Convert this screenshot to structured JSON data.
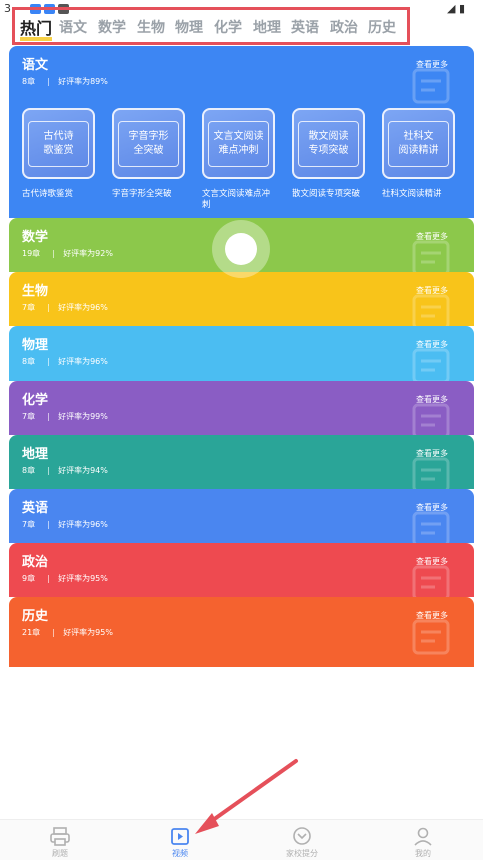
{
  "status_bar": {
    "time": "3",
    "app_icon_colors": [
      "#3a84f5",
      "#3a84f5",
      "#555555"
    ]
  },
  "tabs": [
    {
      "label": "热门",
      "active": true
    },
    {
      "label": "语文"
    },
    {
      "label": "数学"
    },
    {
      "label": "生物"
    },
    {
      "label": "物理"
    },
    {
      "label": "化学"
    },
    {
      "label": "地理"
    },
    {
      "label": "英语"
    },
    {
      "label": "政治"
    },
    {
      "label": "历史"
    }
  ],
  "subjects": [
    {
      "name": "语文",
      "chapters": "8章",
      "rating": "好评率为89%",
      "more": "查看更多",
      "color": "#3d86f3",
      "icon": "notebook-icon",
      "courses": [
        {
          "thumb_text": "古代诗\n歌鉴赏",
          "caption": "古代诗歌鉴赏"
        },
        {
          "thumb_text": "字音字形\n全突破",
          "caption": "字音字形全突破"
        },
        {
          "thumb_text": "文言文阅读\n难点冲刺",
          "caption": "文言文阅读难点冲刺"
        },
        {
          "thumb_text": "散文阅读\n专项突破",
          "caption": "散文阅读专项突破"
        },
        {
          "thumb_text": "社科文\n阅读精讲",
          "caption": "社科文阅读精讲"
        }
      ]
    },
    {
      "name": "数学",
      "chapters": "19章",
      "rating": "好评率为92%",
      "more": "查看更多",
      "color": "#8cc84b",
      "icon": "math-board-icon"
    },
    {
      "name": "生物",
      "chapters": "7章",
      "rating": "好评率为96%",
      "more": "查看更多",
      "color": "#f8c41a",
      "icon": "dna-icon"
    },
    {
      "name": "物理",
      "chapters": "8章",
      "rating": "好评率为96%",
      "more": "查看更多",
      "color": "#4bbdf2",
      "icon": "atom-icon"
    },
    {
      "name": "化学",
      "chapters": "7章",
      "rating": "好评率为99%",
      "more": "查看更多",
      "color": "#8a5dc4",
      "icon": "flask-icon"
    },
    {
      "name": "地理",
      "chapters": "8章",
      "rating": "好评率为94%",
      "more": "查看更多",
      "color": "#2aa598",
      "icon": "globe-icon"
    },
    {
      "name": "英语",
      "chapters": "7章",
      "rating": "好评率为96%",
      "more": "查看更多",
      "color": "#4a86f0",
      "icon": "abc-book-icon"
    },
    {
      "name": "政治",
      "chapters": "9章",
      "rating": "好评率为95%",
      "more": "查看更多",
      "color": "#ee4a50",
      "icon": "ballot-icon"
    },
    {
      "name": "历史",
      "chapters": "21章",
      "rating": "好评率为95%",
      "more": "查看更多",
      "color": "#f5622f",
      "icon": "temple-icon"
    }
  ],
  "bottom_nav": [
    {
      "label": "刷题",
      "icon": "printer-icon"
    },
    {
      "label": "视频",
      "icon": "video-icon",
      "active": true
    },
    {
      "label": "家校提分",
      "icon": "chevron-badge-icon"
    },
    {
      "label": "我的",
      "icon": "user-icon"
    }
  ]
}
